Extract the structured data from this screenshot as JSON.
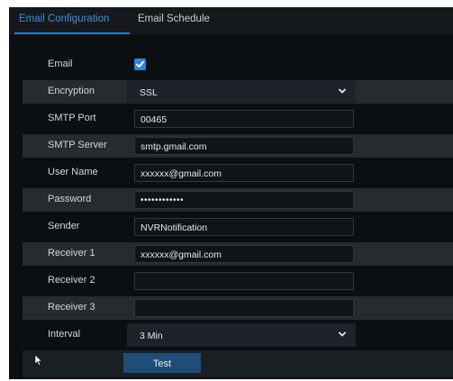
{
  "tabs": [
    {
      "label": "Email Configuration",
      "active": true
    },
    {
      "label": "Email Schedule",
      "active": false
    }
  ],
  "form": {
    "email": {
      "label": "Email",
      "checked": true
    },
    "encryption": {
      "label": "Encryption",
      "value": "SSL"
    },
    "smtp_port": {
      "label": "SMTP Port",
      "value": "00465"
    },
    "smtp_server": {
      "label": "SMTP Server",
      "value": "smtp.gmail.com"
    },
    "user_name": {
      "label": "User Name",
      "value": "xxxxxx@gmail.com"
    },
    "password": {
      "label": "Password",
      "value": "••••••••••••"
    },
    "sender": {
      "label": "Sender",
      "value": "NVRNotification"
    },
    "receiver1": {
      "label": "Receiver 1",
      "value": "xxxxxx@gmail.com"
    },
    "receiver2": {
      "label": "Receiver 2",
      "value": ""
    },
    "receiver3": {
      "label": "Receiver 3",
      "value": ""
    },
    "interval": {
      "label": "Interval",
      "value": "3 Min"
    }
  },
  "actions": {
    "test_label": "Test"
  },
  "icons": {
    "checkbox": "check-icon",
    "dropdown": "chevron-down-icon",
    "pointer": "mouse-pointer-icon"
  },
  "colors": {
    "accent": "#2f86e0",
    "background": "#0c0f12",
    "button": "#1f4d77"
  }
}
